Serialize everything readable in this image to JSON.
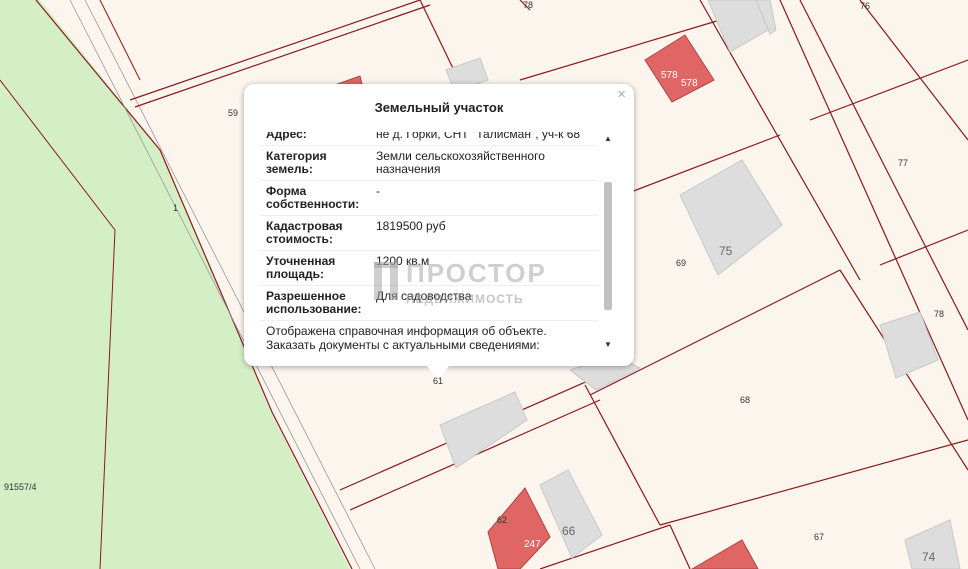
{
  "map": {
    "parcel_numbers": [
      "78",
      "76",
      "59",
      "77",
      "1",
      "69",
      "75",
      "78",
      "61",
      "68",
      "91557/4",
      "62",
      "66",
      "67",
      "74"
    ],
    "red_building_labels": [
      "578",
      "578",
      "247"
    ],
    "colors": {
      "background": "#fbf5ee",
      "forest": "#d4efc6",
      "boundary": "#8b1a1a",
      "building_gray": "#dddddd",
      "building_red": "#e06666"
    }
  },
  "popup": {
    "title": "Земельный участок",
    "close_icon": "×",
    "rows": [
      {
        "key": "Адрес:",
        "value": "не д. Горки, СНТ \"Талисман\", уч-к 68"
      },
      {
        "key": "Категория земель:",
        "value": "Земли сельскохозяйственного назначения"
      },
      {
        "key": "Форма собственности:",
        "value": "-"
      },
      {
        "key": "Кадастровая стоимость:",
        "value": "1819500 руб"
      },
      {
        "key": "Уточненная площадь:",
        "value": "1200 кв.м"
      },
      {
        "key": "Разрешенное использование:",
        "value": "Для садоводства"
      }
    ],
    "note_line1": "Отображена справочная информация об объекте.",
    "note_line2": "Заказать документы с актуальными сведениями:",
    "scroll_up_icon": "▲",
    "scroll_down_icon": "▼"
  },
  "watermark": {
    "line1": "ПРОСТОР",
    "line2": "НЕДВИЖИМОСТЬ"
  }
}
